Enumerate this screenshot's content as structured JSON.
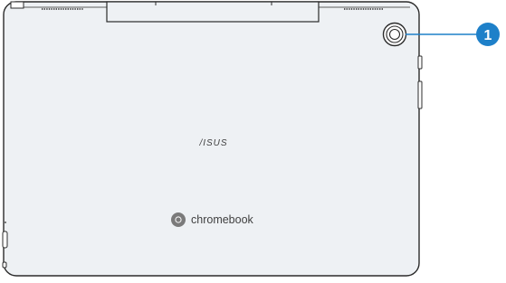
{
  "logo": {
    "asus": "/ISUS",
    "chromebook": "chromebook"
  },
  "callouts": [
    {
      "number": "1",
      "target": "rear-camera"
    }
  ],
  "colors": {
    "outline": "#2b2b2b",
    "body_fill": "#eef1f4",
    "callout_fill": "#1e80c9",
    "callout_line": "#1e80c9",
    "text": "#3f3f3f"
  },
  "icons": {
    "camera": "camera-icon",
    "chrome": "chrome-logo-icon"
  }
}
